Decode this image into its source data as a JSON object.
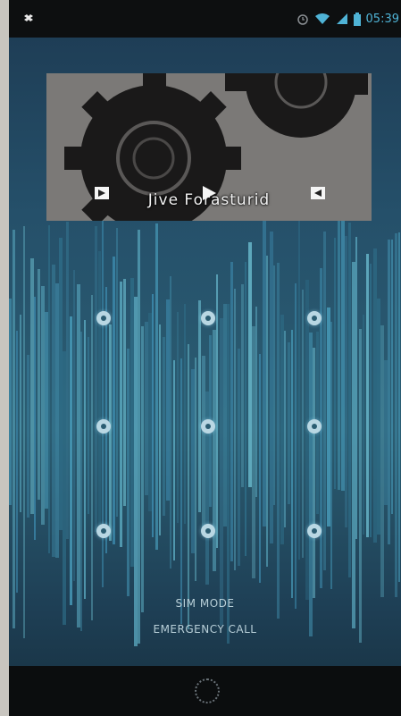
{
  "status_bar": {
    "left_icon": "dropbox-icon",
    "right_icons": [
      "alarm-icon",
      "wifi-icon",
      "signal-icon",
      "battery-icon"
    ],
    "time": "05:39"
  },
  "music_widget": {
    "song_title": "Jive Forasturid",
    "controls": [
      "prev-icon",
      "play-icon",
      "next-icon"
    ]
  },
  "pattern_lock": {
    "dots": 9
  },
  "lock_screen": {
    "sim_status": "SIM MODE",
    "emergency_call": "EMERGENCY CALL"
  },
  "nav_bar": {
    "home_icon": "home-ring-icon"
  },
  "colors": {
    "accent": "#4fb3d6",
    "background_top": "#1d3a52",
    "background_mid": "#2b5d72"
  }
}
